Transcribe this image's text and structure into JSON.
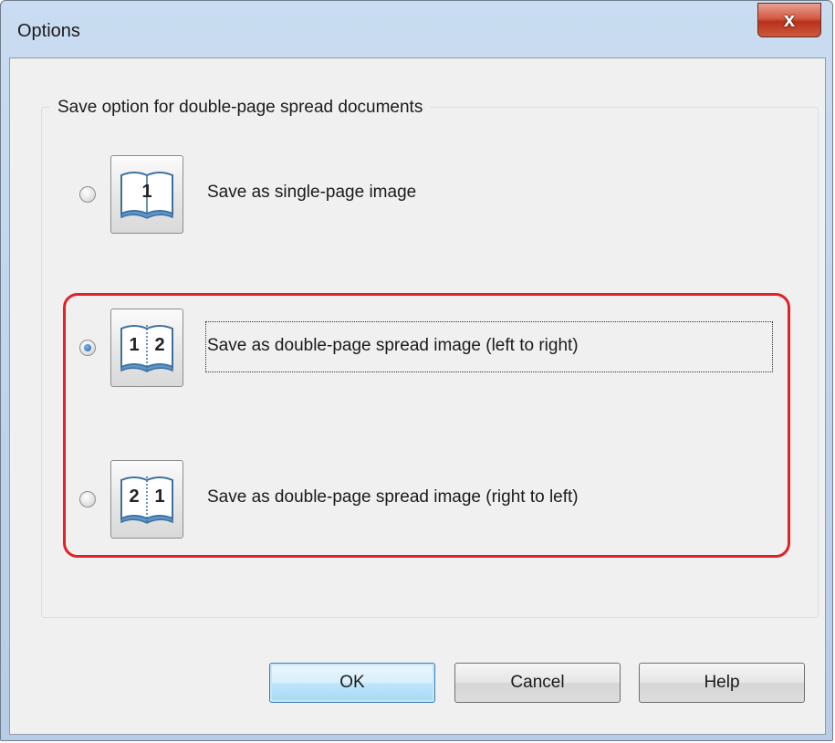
{
  "window": {
    "title": "Options",
    "close_symbol": "x"
  },
  "group": {
    "label": "Save option for double-page spread documents"
  },
  "options": [
    {
      "label": "Save as single-page image",
      "icon": "book-page-1-icon",
      "page_numbers": [
        "1"
      ],
      "checked": false
    },
    {
      "label": "Save as double-page spread image (left to right)",
      "icon": "book-pages-1-2-icon",
      "page_numbers": [
        "1",
        "2"
      ],
      "checked": true
    },
    {
      "label": "Save as double-page spread image (right to left)",
      "icon": "book-pages-2-1-icon",
      "page_numbers": [
        "2",
        "1"
      ],
      "checked": false
    }
  ],
  "buttons": {
    "ok": "OK",
    "cancel": "Cancel",
    "help": "Help"
  },
  "colors": {
    "highlight": "#e02128",
    "title_bar": "#c9dcf1",
    "close_button": "#c9412a"
  }
}
